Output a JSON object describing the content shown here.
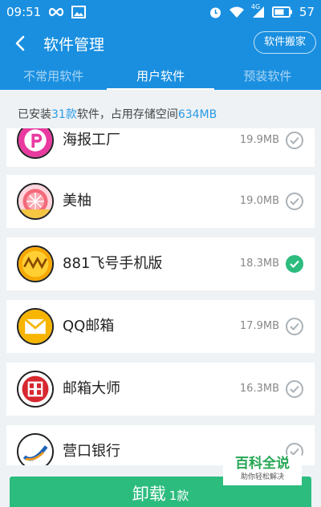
{
  "status_bar": {
    "time": "09:51",
    "battery": "57",
    "signal_label": "4G",
    "icons": [
      "infinity-icon",
      "image-icon",
      "alarm-icon",
      "wifi-icon",
      "cellular-signal-icon",
      "battery-icon"
    ]
  },
  "header": {
    "title": "软件管理",
    "mover_button": "软件搬家",
    "back_icon": "back-arrow-icon"
  },
  "tabs": [
    {
      "label": "不常用软件",
      "active": false
    },
    {
      "label": "用户软件",
      "active": true
    },
    {
      "label": "预装软件",
      "active": false
    }
  ],
  "summary": {
    "prefix": "已安装",
    "count": "31款",
    "middle": "软件，占用存储空间",
    "size": "634MB"
  },
  "apps": [
    {
      "name": "海报工厂",
      "size": "19.9MB",
      "checked": false,
      "icon": "haibao-app-icon"
    },
    {
      "name": "美柚",
      "size": "19.0MB",
      "checked": false,
      "icon": "meiyou-app-icon"
    },
    {
      "name": "881飞号手机版",
      "size": "18.3MB",
      "checked": true,
      "icon": "881-app-icon"
    },
    {
      "name": "QQ邮箱",
      "size": "17.9MB",
      "checked": false,
      "icon": "qqmail-app-icon"
    },
    {
      "name": "邮箱大师",
      "size": "16.3MB",
      "checked": false,
      "icon": "mailmaster-app-icon"
    },
    {
      "name": "营口银行",
      "size": "",
      "checked": false,
      "icon": "yingkou-bank-app-icon"
    }
  ],
  "uninstall": {
    "label": "卸载",
    "count": "1款"
  },
  "watermark": {
    "title": "百科全说",
    "subtitle": "助你轻松解决"
  },
  "colors": {
    "primary": "#1a8fe0",
    "accent_green": "#2cbc7e",
    "highlight_blue": "#2a9be6",
    "background": "#eef2f5"
  }
}
